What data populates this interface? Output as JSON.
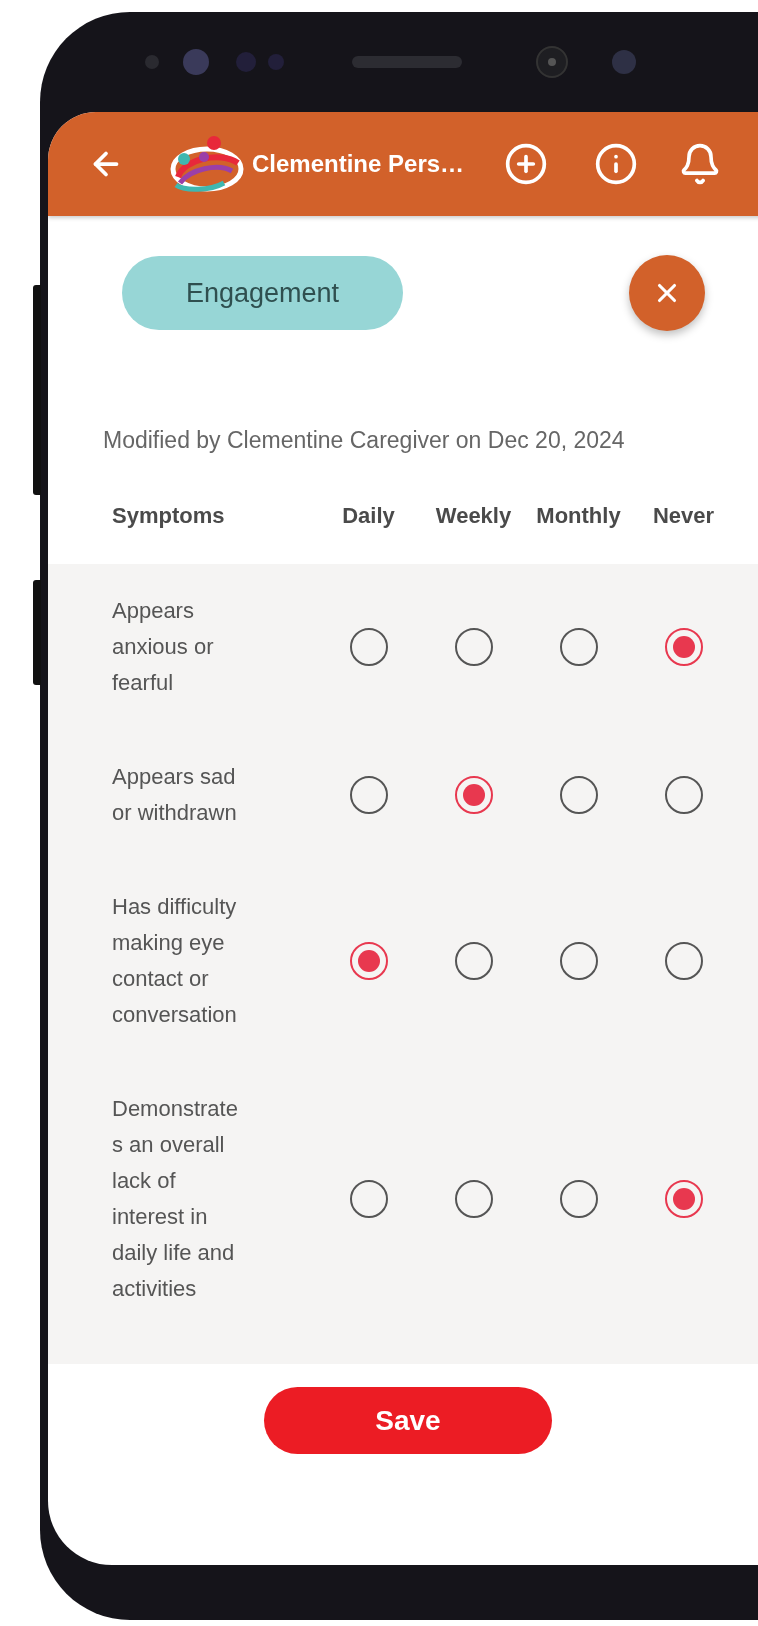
{
  "header": {
    "title": "Clementine Pers…"
  },
  "category": {
    "label": "Engagement"
  },
  "modified_note": "Modified by Clementine Caregiver on Dec 20, 2024",
  "table": {
    "columns": [
      "Symptoms",
      "Daily",
      "Weekly",
      "Monthly",
      "Never"
    ],
    "rows": [
      {
        "symptom": "Appears anxious or fearful",
        "options": [
          {
            "selected": false
          },
          {
            "selected": false
          },
          {
            "selected": false
          },
          {
            "selected": true
          }
        ]
      },
      {
        "symptom": "Appears sad or withdrawn",
        "options": [
          {
            "selected": false
          },
          {
            "selected": true
          },
          {
            "selected": false
          },
          {
            "selected": false
          }
        ]
      },
      {
        "symptom": "Has difficulty making eye contact or conversation",
        "options": [
          {
            "selected": true
          },
          {
            "selected": false
          },
          {
            "selected": false
          },
          {
            "selected": false
          }
        ]
      },
      {
        "symptom": "Demonstrates an overall lack of interest in daily life and activities",
        "options": [
          {
            "selected": false
          },
          {
            "selected": false
          },
          {
            "selected": false
          },
          {
            "selected": true
          }
        ]
      }
    ]
  },
  "save_button": "Save"
}
